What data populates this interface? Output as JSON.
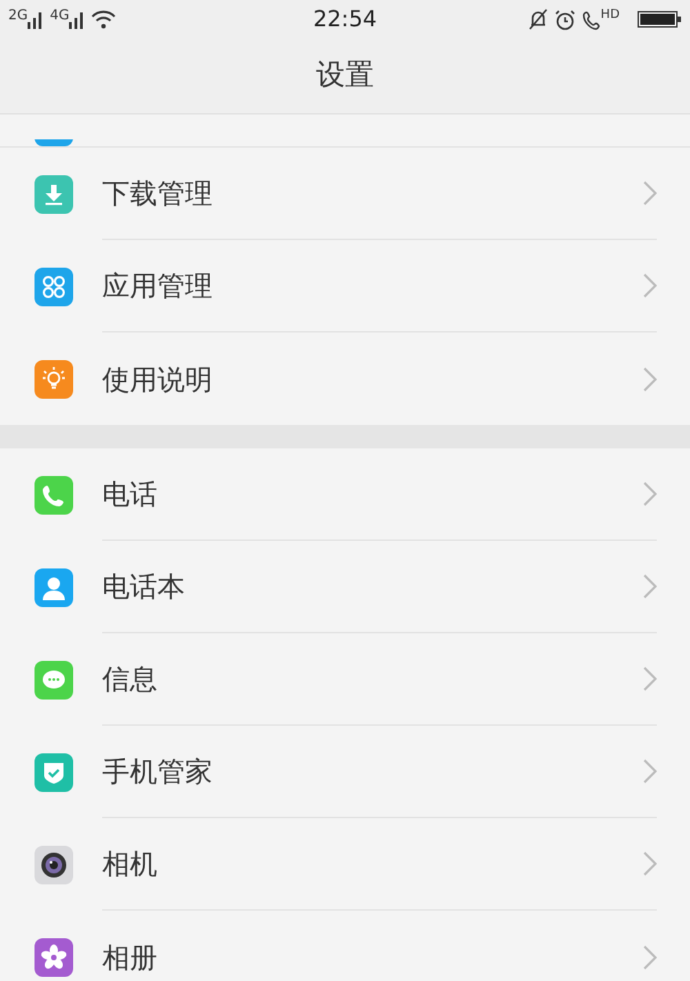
{
  "status_bar": {
    "network_labels": [
      "2G",
      "4G"
    ],
    "time": "22:54",
    "call_label": "HD"
  },
  "title": "设置",
  "scrolled_item": {
    "kind": "apps"
  },
  "sections": [
    {
      "items": [
        {
          "label": "下载管理",
          "kind": "download"
        },
        {
          "label": "应用管理",
          "kind": "apps"
        },
        {
          "label": "使用说明",
          "kind": "bulb"
        }
      ]
    },
    {
      "items": [
        {
          "label": "电话",
          "kind": "phone"
        },
        {
          "label": "电话本",
          "kind": "contacts"
        },
        {
          "label": "信息",
          "kind": "message"
        },
        {
          "label": "手机管家",
          "kind": "shield"
        },
        {
          "label": "相机",
          "kind": "camera"
        },
        {
          "label": "相册",
          "kind": "flower"
        }
      ]
    }
  ]
}
